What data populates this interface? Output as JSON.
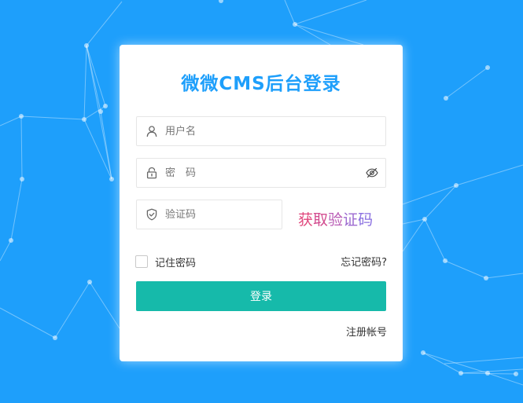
{
  "login_card": {
    "title": "微微CMS后台登录",
    "username": {
      "placeholder": "用户名",
      "value": "",
      "icon": "user-icon"
    },
    "password": {
      "placeholder": "密　码",
      "value": "",
      "icon": "lock-icon",
      "toggle_icon": "eye-icon"
    },
    "captcha": {
      "placeholder": "验证码",
      "value": "",
      "icon": "shield-check-icon",
      "image_text": "获取验证码"
    },
    "remember_label": "记住密码",
    "remember_checked": false,
    "forgot_label": "忘记密码?",
    "login_label": "登录",
    "register_label": "注册帐号"
  },
  "colors": {
    "background": "#1e9ffb",
    "title": "#1e9ffb",
    "login_button": "#16baaa"
  }
}
